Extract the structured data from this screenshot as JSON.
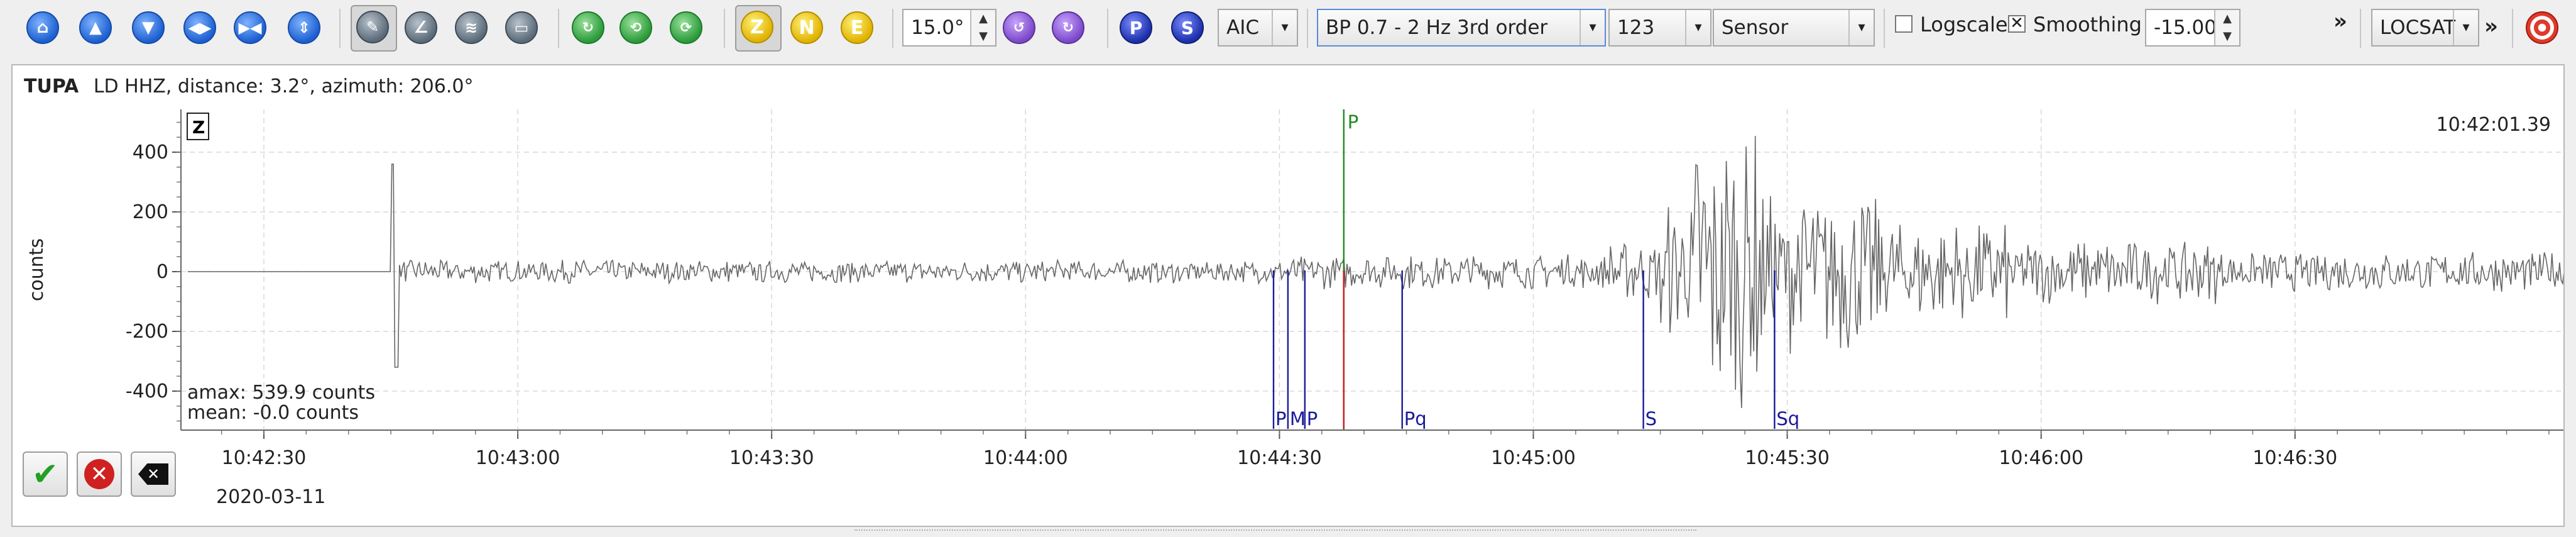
{
  "toolbar": {
    "nav_icons": [
      "home-icon",
      "scroll-up-icon",
      "scroll-down-icon",
      "scroll-left-icon",
      "fit-horizontal-icon",
      "fit-vertical-icon"
    ],
    "tool_icons": [
      "pick-cursor-icon",
      "measure-icon",
      "spectrogram-icon",
      "amplitude-icon"
    ],
    "action_icons": [
      "relocate-icon",
      "relocate-fixed-icon",
      "relocate-free-icon"
    ],
    "components": [
      "Z",
      "N",
      "E"
    ],
    "angle_value": "15.0°",
    "picker_icons": [
      "rotate-left-icon",
      "rotate-right-icon"
    ],
    "phase_buttons": [
      "P",
      "S"
    ],
    "picker_method": "AIC",
    "filter": "BP 0.7 - 2 Hz  3rd order",
    "channel_set": "123",
    "unit": "Sensor",
    "logscale_label": "Logscale",
    "logscale_checked": false,
    "smoothing_label": "Smoothing",
    "smoothing_checked": true,
    "threshold_value": "-15.00",
    "overflow_1": "»",
    "locator": "LOCSAT",
    "overflow_2": "»"
  },
  "trace": {
    "station": "TUPA",
    "network_channel": "LD  HHZ, distance: 3.2°, azimuth: 206.0°",
    "component_badge": "Z",
    "cursor_time": "10:42:01.39",
    "y_label": "counts",
    "amax": "amax: 539.9 counts",
    "mean": "mean: -0.0 counts",
    "date": "2020-03-11",
    "y_ticks": [
      "400",
      "200",
      "0",
      "-200",
      "-400"
    ],
    "x_ticks": [
      "10:42:30",
      "10:43:00",
      "10:43:30",
      "10:44:00",
      "10:44:30",
      "10:45:00",
      "10:45:30",
      "10:46:00",
      "10:46:30"
    ]
  },
  "chart_data": {
    "type": "line",
    "ylabel": "counts",
    "ylim": [
      -540,
      540
    ],
    "y_ticks": [
      400,
      200,
      0,
      -200,
      -400
    ],
    "x_ticks": [
      "10:42:30",
      "10:43:00",
      "10:43:30",
      "10:44:00",
      "10:44:30",
      "10:45:00",
      "10:45:30",
      "10:46:00",
      "10:46:30"
    ],
    "grid": true,
    "picks": [
      {
        "label": "P",
        "time_offset_s": 136.6,
        "color": "#1f8a1f",
        "position": "top"
      },
      {
        "label": "P",
        "time_offset_s": 128.3,
        "color": "#1a1a9a",
        "position": "bottom"
      },
      {
        "label": "M",
        "time_offset_s": 130.0,
        "color": "#1a1a9a",
        "position": "bottom"
      },
      {
        "label": "P",
        "time_offset_s": 132.0,
        "color": "#1a1a9a",
        "position": "bottom"
      },
      {
        "label": "",
        "time_offset_s": 136.6,
        "color": "#d01a1a",
        "position": "bottom"
      },
      {
        "label": "Pq",
        "time_offset_s": 143.5,
        "color": "#1a1a9a",
        "position": "bottom"
      },
      {
        "label": "S",
        "time_offset_s": 172.0,
        "color": "#1a1a9a",
        "position": "bottom"
      },
      {
        "label": "Sq",
        "time_offset_s": 187.5,
        "color": "#1a1a9a",
        "position": "bottom"
      }
    ],
    "envelope_segments": [
      {
        "from_s": 0,
        "to_s": 24,
        "amp": 0
      },
      {
        "from_s": 24,
        "to_s": 25,
        "amp": 360
      },
      {
        "from_s": 25,
        "to_s": 130,
        "amp": 40
      },
      {
        "from_s": 130,
        "to_s": 168,
        "amp": 60
      },
      {
        "from_s": 168,
        "to_s": 174,
        "amp": 110
      },
      {
        "from_s": 174,
        "to_s": 178,
        "amp": 240
      },
      {
        "from_s": 178,
        "to_s": 186,
        "amp": 500
      },
      {
        "from_s": 186,
        "to_s": 200,
        "amp": 280
      },
      {
        "from_s": 200,
        "to_s": 215,
        "amp": 180
      },
      {
        "from_s": 215,
        "to_s": 240,
        "amp": 110
      },
      {
        "from_s": 240,
        "to_s": 285,
        "amp": 70
      }
    ]
  },
  "colors": {
    "trace": "#666666",
    "grid": "#d8d8d8",
    "pick_blue": "#1a1a9a",
    "pick_green": "#1f8a1f",
    "pick_red": "#d01a1a"
  },
  "buttons": {
    "accept": "accept-check-icon",
    "reject": "reject-x-icon",
    "clear": "clear-delete-icon"
  }
}
